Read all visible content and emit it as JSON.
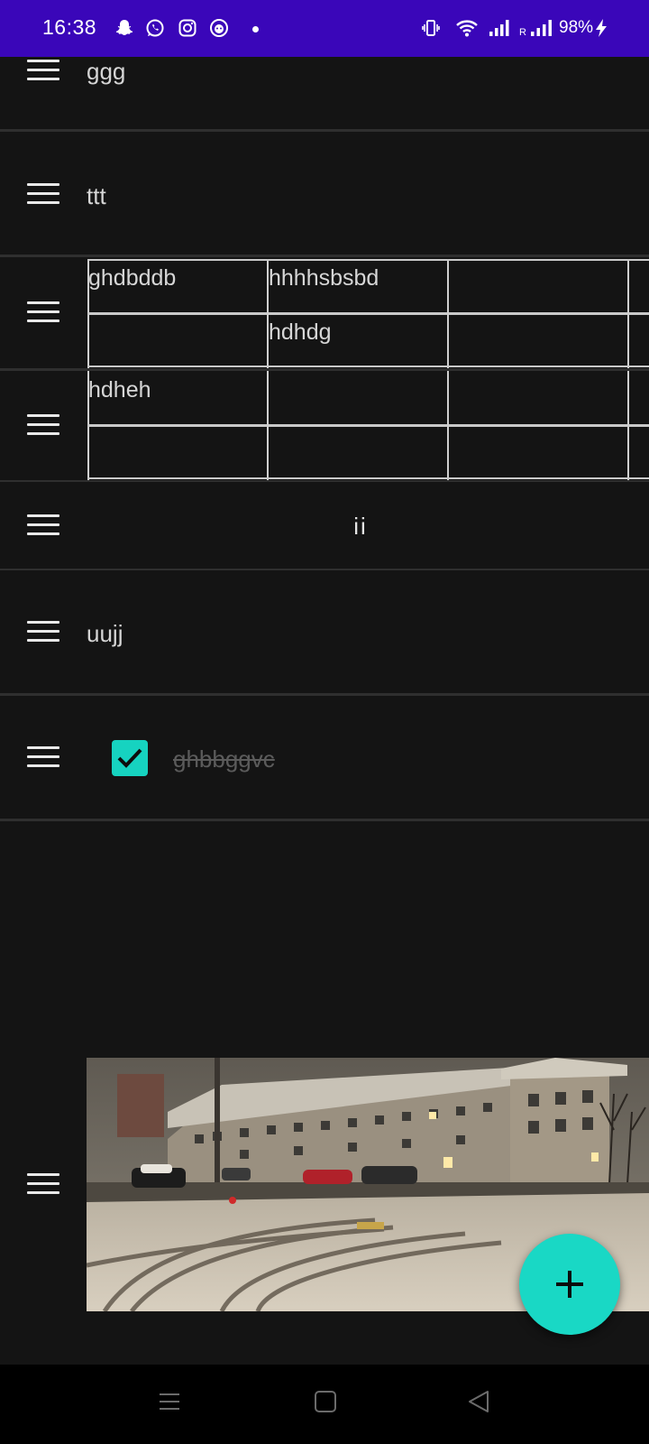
{
  "status_bar": {
    "time": "16:38",
    "notification_icons": [
      "snapchat-icon",
      "whatsapp-icon",
      "instagram-icon",
      "app-icon"
    ],
    "battery": "98%",
    "roaming_label": "R",
    "colors": {
      "background": "#3a06b9"
    }
  },
  "list": {
    "items": [
      {
        "type": "text",
        "text": "ggg"
      },
      {
        "type": "text",
        "text": "ttt"
      },
      {
        "type": "table",
        "cells": [
          [
            "ghdbddb",
            "hhhhsbsbd",
            "",
            ""
          ],
          [
            "",
            "hdhdg",
            "",
            ""
          ]
        ]
      },
      {
        "type": "table",
        "cells": [
          [
            "hdheh",
            "",
            "",
            ""
          ],
          [
            "",
            "",
            "",
            ""
          ]
        ]
      },
      {
        "type": "heading",
        "text": "ii"
      },
      {
        "type": "text",
        "text": "uujj"
      },
      {
        "type": "checkbox",
        "checked": true,
        "text": "ghbbggvc"
      },
      {
        "type": "image",
        "description": "photo"
      }
    ]
  },
  "fab": {
    "icon": "plus-icon",
    "color": "#19d8c5"
  },
  "nav_bar": {
    "buttons": [
      "menu-icon",
      "home-icon",
      "back-icon"
    ]
  }
}
